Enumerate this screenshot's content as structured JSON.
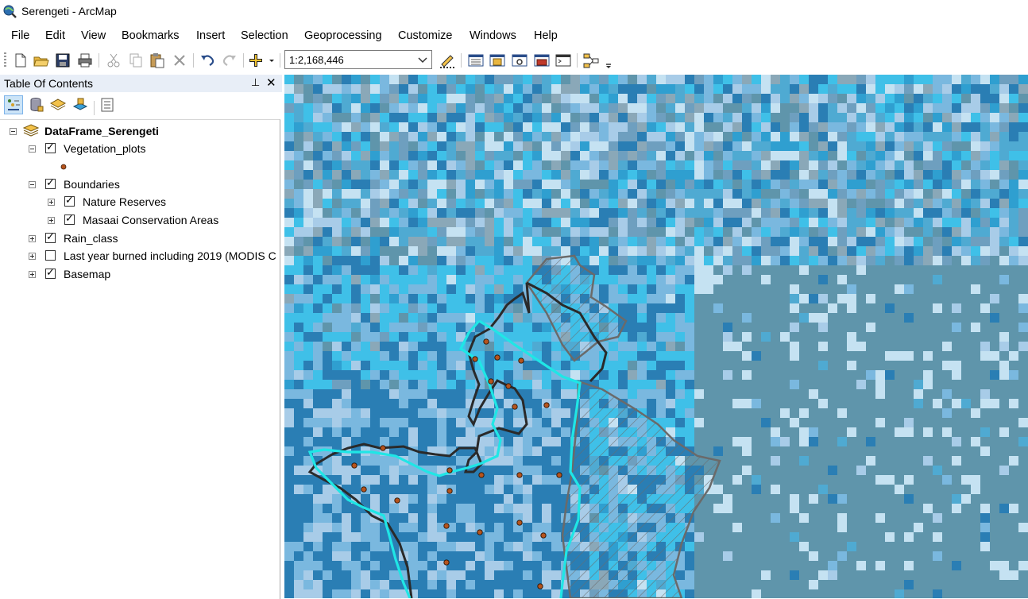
{
  "window": {
    "title": "Serengeti - ArcMap"
  },
  "menu": [
    "File",
    "Edit",
    "View",
    "Bookmarks",
    "Insert",
    "Selection",
    "Geoprocessing",
    "Customize",
    "Windows",
    "Help"
  ],
  "toolbar": {
    "scale": "1:2,168,446"
  },
  "toc": {
    "title": "Table Of Contents",
    "pin_glyph": "⊥",
    "close_glyph": "✕",
    "dataframe": "DataFrame_Serengeti",
    "layers": [
      {
        "label": "Vegetation_plots",
        "checked": true,
        "expanded": true
      },
      {
        "label": "Boundaries",
        "checked": true,
        "expanded": true
      },
      {
        "label": "Nature Reserves",
        "checked": true,
        "expanded": false
      },
      {
        "label": "Masaai Conservation Areas",
        "checked": true,
        "expanded": false
      },
      {
        "label": "Rain_class",
        "checked": true,
        "expanded": false
      },
      {
        "label": "Last year burned including 2019 (MODIS C",
        "checked": false,
        "expanded": false
      },
      {
        "label": "Basemap",
        "checked": true,
        "expanded": false
      }
    ]
  },
  "colors": {
    "raster_palette": [
      "#2a7eb4",
      "#4faad2",
      "#7ab8df",
      "#a8cce8",
      "#3fc0e8",
      "#5f95ab",
      "#8aa8b8",
      "#c5e2f2",
      "#2f9fd0",
      "#6e9fbf"
    ],
    "plot_marker": "#b5541d",
    "reserve_outline": "#2a2a2a",
    "conservation_outline": "#1fe6e6",
    "masaai_hatch": "#6a6a6a"
  }
}
